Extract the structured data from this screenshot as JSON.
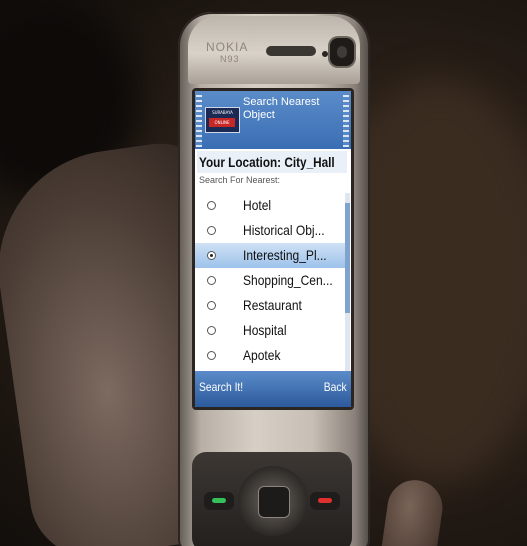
{
  "photo": {
    "subject": "A hand holding a mobile phone showing a location search app"
  },
  "phone": {
    "brand": "NOKIA",
    "model": "N93"
  },
  "app": {
    "logo_line1": "SURABAYA",
    "logo_line2": "ONLINE",
    "title": "Search Nearest Object",
    "location_label": "Your Location: City_Hall",
    "search_label": "Search For Nearest:",
    "options": [
      {
        "label": "Hotel",
        "selected": false
      },
      {
        "label": "Historical Obj...",
        "selected": false
      },
      {
        "label": "Interesting_Pl...",
        "selected": true
      },
      {
        "label": "Shopping_Cen...",
        "selected": false
      },
      {
        "label": "Restaurant",
        "selected": false
      },
      {
        "label": "Hospital",
        "selected": false
      },
      {
        "label": "Apotek",
        "selected": false
      }
    ],
    "softkey_left": "Search It!",
    "softkey_right": "Back",
    "colors": {
      "header": "#3a6eb4",
      "selection": "#9dc2ea"
    }
  }
}
